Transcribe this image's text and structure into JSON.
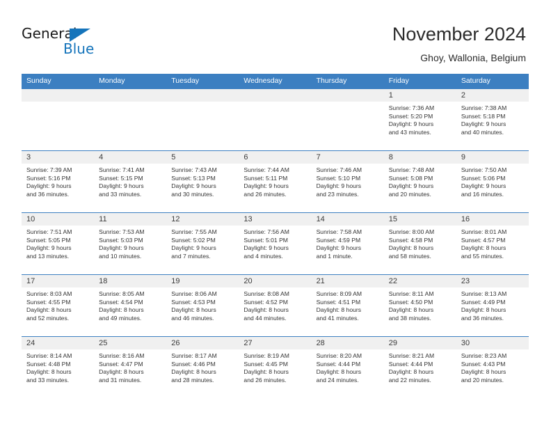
{
  "brand": {
    "name_part1": "General",
    "name_part2": "Blue",
    "triangle_color": "#1574bb",
    "blue_text_color": "#1574bb"
  },
  "header": {
    "title": "November 2024",
    "subtitle": "Ghoy, Wallonia, Belgium"
  },
  "theme": {
    "header_blue": "#3c7fc1",
    "daynum_band": "#f0f0f0",
    "text": "#333333"
  },
  "weekdays": [
    "Sunday",
    "Monday",
    "Tuesday",
    "Wednesday",
    "Thursday",
    "Friday",
    "Saturday"
  ],
  "weeks": [
    [
      {
        "day": "",
        "sunrise": "",
        "sunset": "",
        "daylight1": "",
        "daylight2": ""
      },
      {
        "day": "",
        "sunrise": "",
        "sunset": "",
        "daylight1": "",
        "daylight2": ""
      },
      {
        "day": "",
        "sunrise": "",
        "sunset": "",
        "daylight1": "",
        "daylight2": ""
      },
      {
        "day": "",
        "sunrise": "",
        "sunset": "",
        "daylight1": "",
        "daylight2": ""
      },
      {
        "day": "",
        "sunrise": "",
        "sunset": "",
        "daylight1": "",
        "daylight2": ""
      },
      {
        "day": "1",
        "sunrise": "Sunrise: 7:36 AM",
        "sunset": "Sunset: 5:20 PM",
        "daylight1": "Daylight: 9 hours",
        "daylight2": "and 43 minutes."
      },
      {
        "day": "2",
        "sunrise": "Sunrise: 7:38 AM",
        "sunset": "Sunset: 5:18 PM",
        "daylight1": "Daylight: 9 hours",
        "daylight2": "and 40 minutes."
      }
    ],
    [
      {
        "day": "3",
        "sunrise": "Sunrise: 7:39 AM",
        "sunset": "Sunset: 5:16 PM",
        "daylight1": "Daylight: 9 hours",
        "daylight2": "and 36 minutes."
      },
      {
        "day": "4",
        "sunrise": "Sunrise: 7:41 AM",
        "sunset": "Sunset: 5:15 PM",
        "daylight1": "Daylight: 9 hours",
        "daylight2": "and 33 minutes."
      },
      {
        "day": "5",
        "sunrise": "Sunrise: 7:43 AM",
        "sunset": "Sunset: 5:13 PM",
        "daylight1": "Daylight: 9 hours",
        "daylight2": "and 30 minutes."
      },
      {
        "day": "6",
        "sunrise": "Sunrise: 7:44 AM",
        "sunset": "Sunset: 5:11 PM",
        "daylight1": "Daylight: 9 hours",
        "daylight2": "and 26 minutes."
      },
      {
        "day": "7",
        "sunrise": "Sunrise: 7:46 AM",
        "sunset": "Sunset: 5:10 PM",
        "daylight1": "Daylight: 9 hours",
        "daylight2": "and 23 minutes."
      },
      {
        "day": "8",
        "sunrise": "Sunrise: 7:48 AM",
        "sunset": "Sunset: 5:08 PM",
        "daylight1": "Daylight: 9 hours",
        "daylight2": "and 20 minutes."
      },
      {
        "day": "9",
        "sunrise": "Sunrise: 7:50 AM",
        "sunset": "Sunset: 5:06 PM",
        "daylight1": "Daylight: 9 hours",
        "daylight2": "and 16 minutes."
      }
    ],
    [
      {
        "day": "10",
        "sunrise": "Sunrise: 7:51 AM",
        "sunset": "Sunset: 5:05 PM",
        "daylight1": "Daylight: 9 hours",
        "daylight2": "and 13 minutes."
      },
      {
        "day": "11",
        "sunrise": "Sunrise: 7:53 AM",
        "sunset": "Sunset: 5:03 PM",
        "daylight1": "Daylight: 9 hours",
        "daylight2": "and 10 minutes."
      },
      {
        "day": "12",
        "sunrise": "Sunrise: 7:55 AM",
        "sunset": "Sunset: 5:02 PM",
        "daylight1": "Daylight: 9 hours",
        "daylight2": "and 7 minutes."
      },
      {
        "day": "13",
        "sunrise": "Sunrise: 7:56 AM",
        "sunset": "Sunset: 5:01 PM",
        "daylight1": "Daylight: 9 hours",
        "daylight2": "and 4 minutes."
      },
      {
        "day": "14",
        "sunrise": "Sunrise: 7:58 AM",
        "sunset": "Sunset: 4:59 PM",
        "daylight1": "Daylight: 9 hours",
        "daylight2": "and 1 minute."
      },
      {
        "day": "15",
        "sunrise": "Sunrise: 8:00 AM",
        "sunset": "Sunset: 4:58 PM",
        "daylight1": "Daylight: 8 hours",
        "daylight2": "and 58 minutes."
      },
      {
        "day": "16",
        "sunrise": "Sunrise: 8:01 AM",
        "sunset": "Sunset: 4:57 PM",
        "daylight1": "Daylight: 8 hours",
        "daylight2": "and 55 minutes."
      }
    ],
    [
      {
        "day": "17",
        "sunrise": "Sunrise: 8:03 AM",
        "sunset": "Sunset: 4:55 PM",
        "daylight1": "Daylight: 8 hours",
        "daylight2": "and 52 minutes."
      },
      {
        "day": "18",
        "sunrise": "Sunrise: 8:05 AM",
        "sunset": "Sunset: 4:54 PM",
        "daylight1": "Daylight: 8 hours",
        "daylight2": "and 49 minutes."
      },
      {
        "day": "19",
        "sunrise": "Sunrise: 8:06 AM",
        "sunset": "Sunset: 4:53 PM",
        "daylight1": "Daylight: 8 hours",
        "daylight2": "and 46 minutes."
      },
      {
        "day": "20",
        "sunrise": "Sunrise: 8:08 AM",
        "sunset": "Sunset: 4:52 PM",
        "daylight1": "Daylight: 8 hours",
        "daylight2": "and 44 minutes."
      },
      {
        "day": "21",
        "sunrise": "Sunrise: 8:09 AM",
        "sunset": "Sunset: 4:51 PM",
        "daylight1": "Daylight: 8 hours",
        "daylight2": "and 41 minutes."
      },
      {
        "day": "22",
        "sunrise": "Sunrise: 8:11 AM",
        "sunset": "Sunset: 4:50 PM",
        "daylight1": "Daylight: 8 hours",
        "daylight2": "and 38 minutes."
      },
      {
        "day": "23",
        "sunrise": "Sunrise: 8:13 AM",
        "sunset": "Sunset: 4:49 PM",
        "daylight1": "Daylight: 8 hours",
        "daylight2": "and 36 minutes."
      }
    ],
    [
      {
        "day": "24",
        "sunrise": "Sunrise: 8:14 AM",
        "sunset": "Sunset: 4:48 PM",
        "daylight1": "Daylight: 8 hours",
        "daylight2": "and 33 minutes."
      },
      {
        "day": "25",
        "sunrise": "Sunrise: 8:16 AM",
        "sunset": "Sunset: 4:47 PM",
        "daylight1": "Daylight: 8 hours",
        "daylight2": "and 31 minutes."
      },
      {
        "day": "26",
        "sunrise": "Sunrise: 8:17 AM",
        "sunset": "Sunset: 4:46 PM",
        "daylight1": "Daylight: 8 hours",
        "daylight2": "and 28 minutes."
      },
      {
        "day": "27",
        "sunrise": "Sunrise: 8:19 AM",
        "sunset": "Sunset: 4:45 PM",
        "daylight1": "Daylight: 8 hours",
        "daylight2": "and 26 minutes."
      },
      {
        "day": "28",
        "sunrise": "Sunrise: 8:20 AM",
        "sunset": "Sunset: 4:44 PM",
        "daylight1": "Daylight: 8 hours",
        "daylight2": "and 24 minutes."
      },
      {
        "day": "29",
        "sunrise": "Sunrise: 8:21 AM",
        "sunset": "Sunset: 4:44 PM",
        "daylight1": "Daylight: 8 hours",
        "daylight2": "and 22 minutes."
      },
      {
        "day": "30",
        "sunrise": "Sunrise: 8:23 AM",
        "sunset": "Sunset: 4:43 PM",
        "daylight1": "Daylight: 8 hours",
        "daylight2": "and 20 minutes."
      }
    ]
  ]
}
